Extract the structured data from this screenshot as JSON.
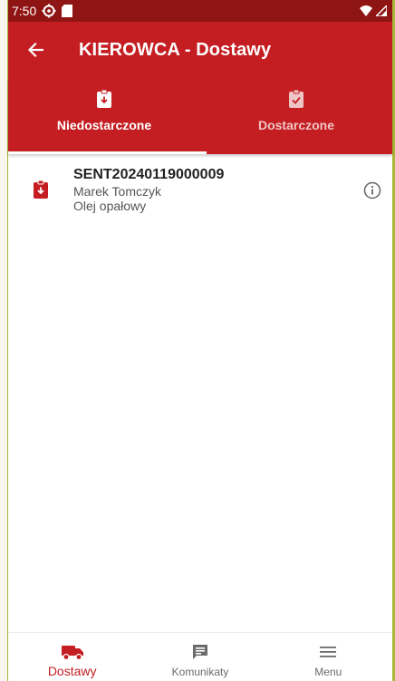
{
  "status_bar": {
    "time": "7:50",
    "icons": [
      "vpn-icon",
      "sd-card-icon",
      "wifi-icon",
      "signal-icon"
    ]
  },
  "app_bar": {
    "title": "KIEROWCA - Dostawy",
    "back_icon": "arrow-back-icon"
  },
  "tabs": [
    {
      "label": "Niedostarczone",
      "icon": "clipboard-arrow-down-icon",
      "selected": true
    },
    {
      "label": "Dostarczone",
      "icon": "clipboard-check-icon",
      "selected": false
    }
  ],
  "deliveries": [
    {
      "code": "SENT20240119000009",
      "driver": "Marek Tomczyk",
      "product": "Olej opałowy",
      "icon": "clipboard-arrow-down-icon",
      "action_icon": "info-icon"
    }
  ],
  "bottom_nav": [
    {
      "label": "Dostawy",
      "icon": "truck-icon",
      "active": true
    },
    {
      "label": "Komunikaty",
      "icon": "message-icon",
      "active": false
    },
    {
      "label": "Menu",
      "icon": "menu-icon",
      "active": false
    }
  ],
  "colors": {
    "primary": "#c41e22",
    "status_bar": "#8f1414",
    "inactive_tab": "#f0c5c6",
    "nav_inactive": "#6b6b6b"
  }
}
